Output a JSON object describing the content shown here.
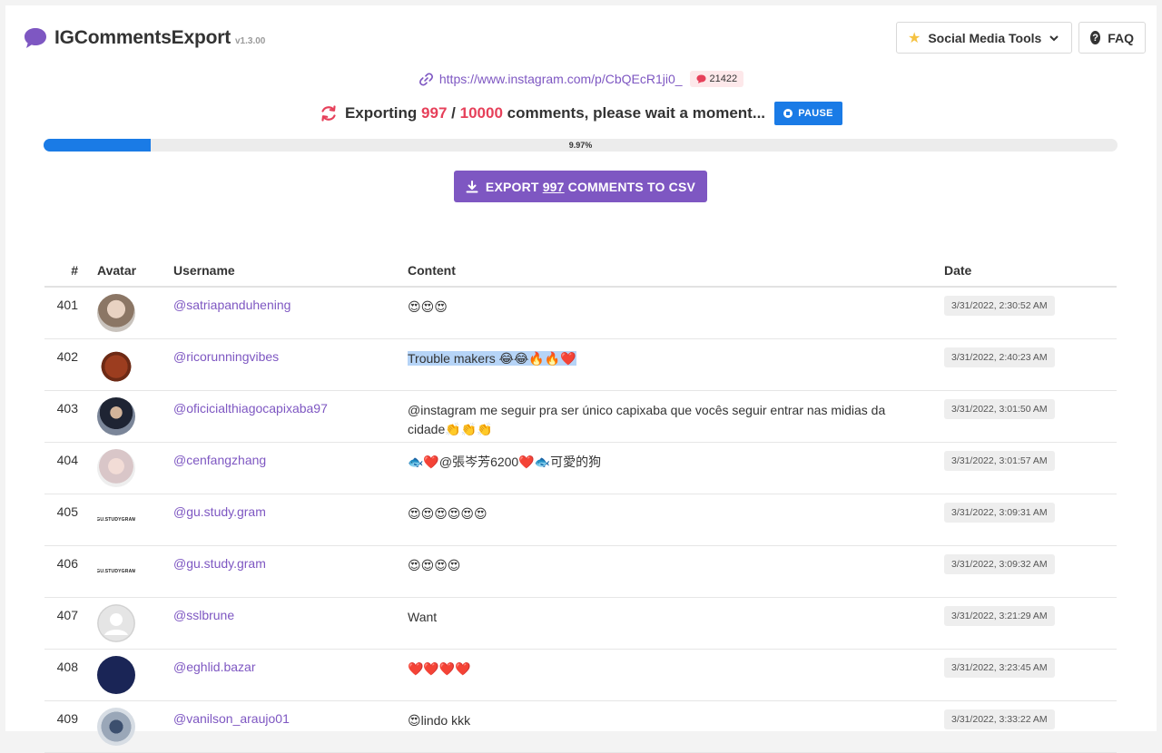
{
  "app": {
    "name": "IGCommentsExport",
    "version": "v1.3.00"
  },
  "header": {
    "tools_label": "Social Media Tools",
    "faq_label": "FAQ"
  },
  "post": {
    "url": "https://www.instagram.com/p/CbQEcR1ji0_",
    "comment_count": "21422"
  },
  "status": {
    "prefix": "Exporting",
    "current": "997",
    "separator": "/",
    "total": "10000",
    "suffix": "comments, please wait a moment...",
    "pause_label": "PAUSE"
  },
  "progress": {
    "fraction": 0.0997,
    "label": "9.97%"
  },
  "export": {
    "prefix": "EXPORT",
    "count": "997",
    "suffix": "COMMENTS TO CSV"
  },
  "table": {
    "headers": {
      "num": "#",
      "avatar": "Avatar",
      "username": "Username",
      "content": "Content",
      "date": "Date"
    },
    "rows": [
      {
        "num": "401",
        "username": "@satriapanduhening",
        "content": "😍😍😍",
        "date": "3/31/2022, 2:30:52 AM",
        "avatar": "photo-man"
      },
      {
        "num": "402",
        "username": "@ricorunningvibes",
        "content": "Trouble makers 😂😂🔥🔥❤️",
        "date": "3/31/2022, 2:40:23 AM",
        "avatar": "dog"
      },
      {
        "num": "403",
        "username": "@oficicialthiagocapixaba97",
        "content": "@instagram me seguir pra ser único capixaba que vocês seguir entrar nas midias da cidade👏👏👏",
        "date": "3/31/2022, 3:01:50 AM",
        "avatar": "photo-dark"
      },
      {
        "num": "404",
        "username": "@cenfangzhang",
        "content": "🐟❤️@張岑芳6200❤️🐟可愛的狗",
        "date": "3/31/2022, 3:01:57 AM",
        "avatar": "photo-light"
      },
      {
        "num": "405",
        "username": "@gu.study.gram",
        "content": "😍😍😍😍😍😍",
        "date": "3/31/2022, 3:09:31 AM",
        "avatar": "brand",
        "avatar_text": "GU.STUDYGRAM"
      },
      {
        "num": "406",
        "username": "@gu.study.gram",
        "content": "😍😍😍😍",
        "date": "3/31/2022, 3:09:32 AM",
        "avatar": "brand",
        "avatar_text": "GU.STUDYGRAM"
      },
      {
        "num": "407",
        "username": "@sslbrune",
        "content": "Want",
        "date": "3/31/2022, 3:21:29 AM",
        "avatar": "ghost"
      },
      {
        "num": "408",
        "username": "@eghlid.bazar",
        "content": "❤️❤️❤️❤️",
        "date": "3/31/2022, 3:23:45 AM",
        "avatar": "logo-navy"
      },
      {
        "num": "409",
        "username": "@vanilson_araujo01",
        "content": "😍lindo kkk",
        "date": "3/31/2022, 3:33:22 AM",
        "avatar": "photo-gray"
      }
    ]
  },
  "colors": {
    "accent": "#7e57c2",
    "primary": "#1a7be6",
    "highlight": "#e6405a"
  }
}
